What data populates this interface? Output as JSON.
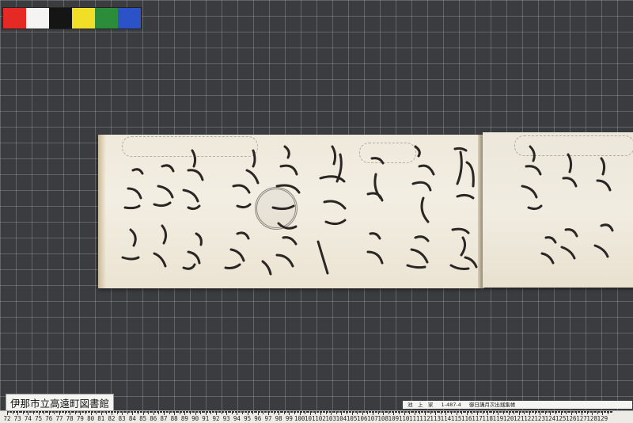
{
  "color_bar": {
    "swatches": [
      "#e52a26",
      "#f4f4f2",
      "#151515",
      "#f1de27",
      "#2b8d3a",
      "#2c52c8"
    ]
  },
  "label": {
    "institution": "伊那市立高遠町図書館"
  },
  "info_strip": {
    "collection": "池　上　家",
    "code": "1-487-4",
    "title": "御日講月次出銭集帳"
  },
  "ruler": {
    "labels": [
      "72",
      "73",
      "74",
      "75",
      "76",
      "77",
      "78",
      "79",
      "80",
      "81",
      "82",
      "83",
      "84",
      "85",
      "86",
      "87",
      "88",
      "89",
      "90",
      "91",
      "92",
      "93",
      "94",
      "95",
      "96",
      "97",
      "98",
      "99",
      "100",
      "101",
      "102",
      "103",
      "104",
      "105",
      "106",
      "107",
      "108",
      "109",
      "110",
      "111",
      "112",
      "113",
      "114",
      "115",
      "116",
      "117",
      "118",
      "119",
      "120",
      "121",
      "122",
      "123",
      "124",
      "125",
      "126",
      "127",
      "128",
      "129"
    ]
  }
}
